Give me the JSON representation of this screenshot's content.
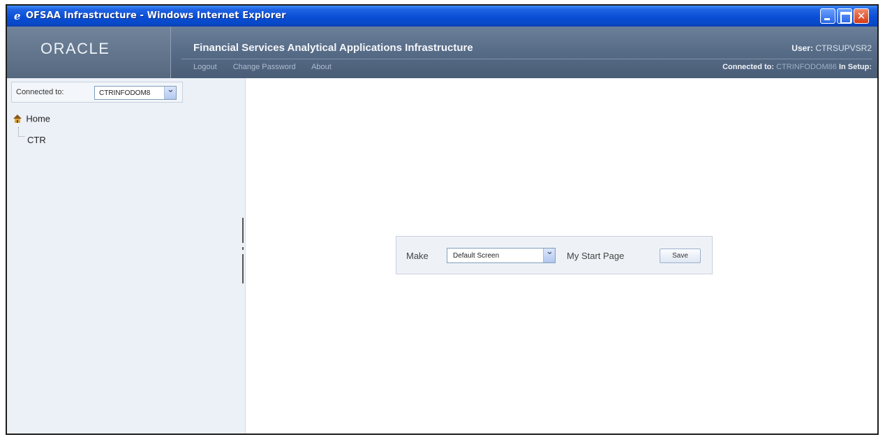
{
  "window": {
    "title": "OFSAA Infrastructure - Windows Internet Explorer",
    "icon": "ie-icon"
  },
  "header": {
    "logo": "ORACLE",
    "app_title": "Financial Services Analytical Applications Infrastructure",
    "nav": [
      "Logout",
      "Change Password",
      "About"
    ],
    "user_label": "User:",
    "user_value": "CTRSUPVSR2",
    "connected_label": "Connected to:",
    "connected_value": "CTRINFODOM86",
    "in_setup": "In Setup:"
  },
  "sidebar": {
    "connected_label": "Connected to:",
    "connected_value": "CTRINFODOM8",
    "tree": {
      "root": "Home",
      "child": "CTR"
    }
  },
  "main": {
    "make_label": "Make",
    "screen_select_value": "Default Screen",
    "my_start_page_label": "My Start Page",
    "save_label": "Save"
  },
  "colors": {
    "titlebar": "#0a4ed6",
    "header": "#566b86",
    "sidebar_bg": "#ecf1f8"
  }
}
